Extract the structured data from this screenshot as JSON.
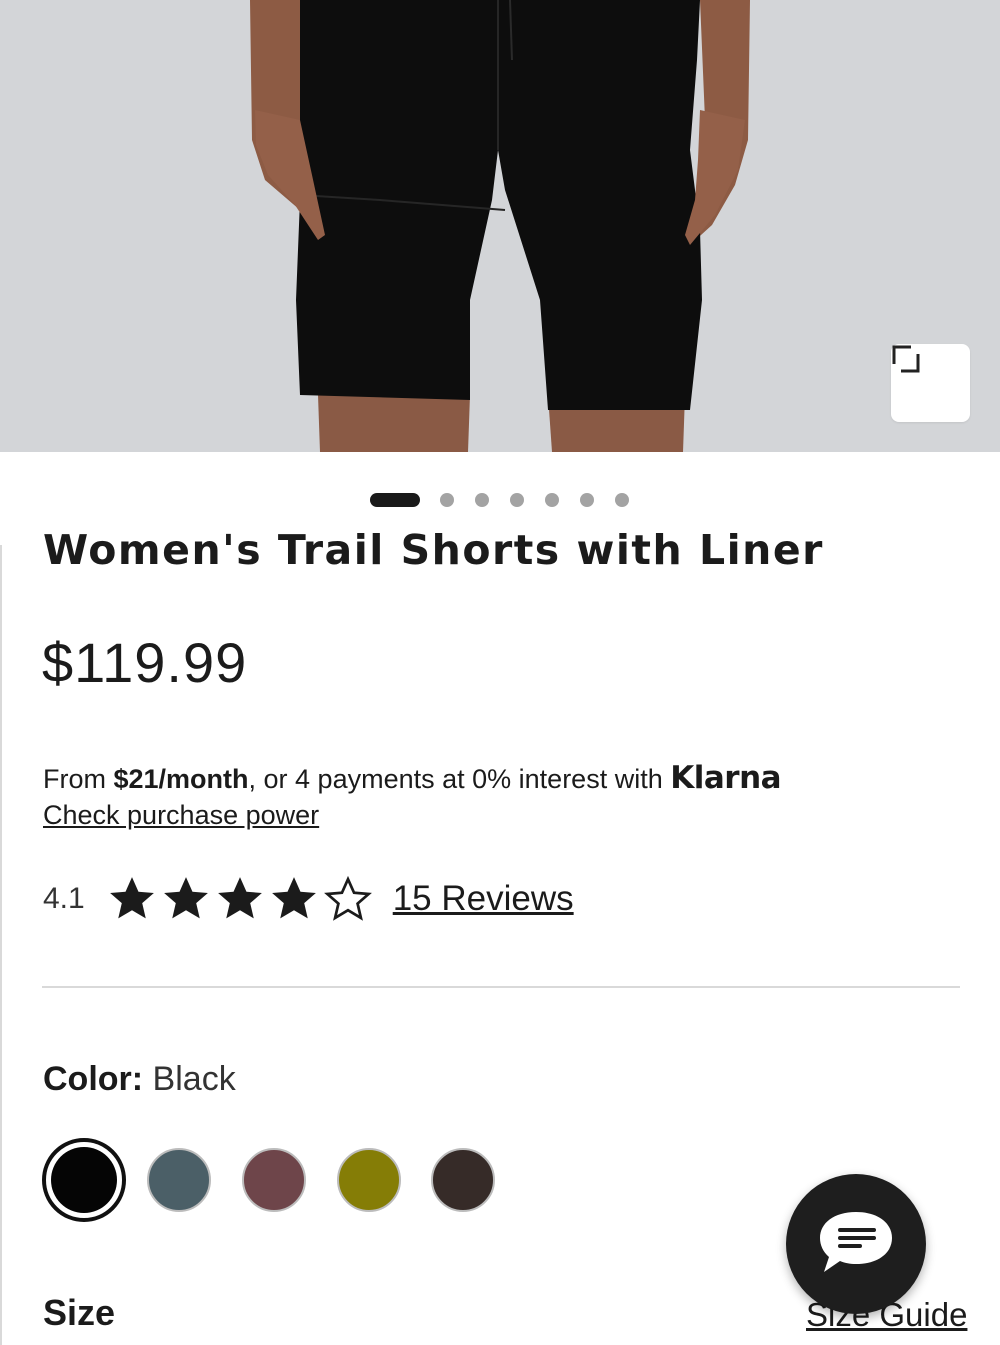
{
  "product": {
    "title": "Women's Trail Shorts with Liner",
    "price": "$119.99",
    "image_alt": "Black trail shorts worn by model"
  },
  "carousel": {
    "count": 7,
    "active_index": 0
  },
  "klarna": {
    "prefix": "From ",
    "monthly": "$21/month",
    "suffix": ", or 4 payments at 0% interest with ",
    "brand": "Klarna",
    "link": "Check purchase power"
  },
  "rating": {
    "value": "4.1",
    "stars_filled": 4,
    "stars_total": 5,
    "reviews_link": "15 Reviews"
  },
  "color": {
    "label": "Color:",
    "selected": "Black",
    "swatches": [
      "#050505",
      "#4b5f67",
      "#6e454a",
      "#857d06",
      "#362b28"
    ]
  },
  "size": {
    "label": "Size",
    "guide_link": "Size Guide"
  },
  "icons": {
    "expand": "expand-icon",
    "chat": "chat-icon",
    "star": "star-icon"
  }
}
